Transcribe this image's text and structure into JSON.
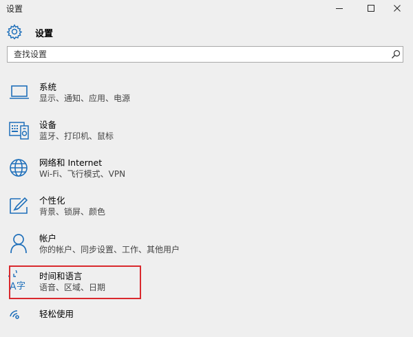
{
  "window": {
    "title": "设置"
  },
  "header": {
    "title": "设置"
  },
  "search": {
    "placeholder": "查找设置"
  },
  "categories": [
    {
      "title": "系统",
      "subtitle": "显示、通知、应用、电源",
      "icon": "laptop-icon"
    },
    {
      "title": "设备",
      "subtitle": "蓝牙、打印机、鼠标",
      "icon": "devices-icon"
    },
    {
      "title": "网络和 Internet",
      "subtitle": "Wi-Fi、飞行模式、VPN",
      "icon": "globe-icon"
    },
    {
      "title": "个性化",
      "subtitle": "背景、锁屏、颜色",
      "icon": "paint-icon"
    },
    {
      "title": "帐户",
      "subtitle": "你的帐户、同步设置、工作、其他用户",
      "icon": "person-icon"
    },
    {
      "title": "时间和语言",
      "subtitle": "语音、区域、日期",
      "icon": "time-language-icon"
    },
    {
      "title": "轻松使用",
      "subtitle": "",
      "icon": "ease-of-access-icon"
    }
  ],
  "colors": {
    "accent": "#1e6fba",
    "highlight_border": "#d9282d",
    "background": "#efefef"
  }
}
